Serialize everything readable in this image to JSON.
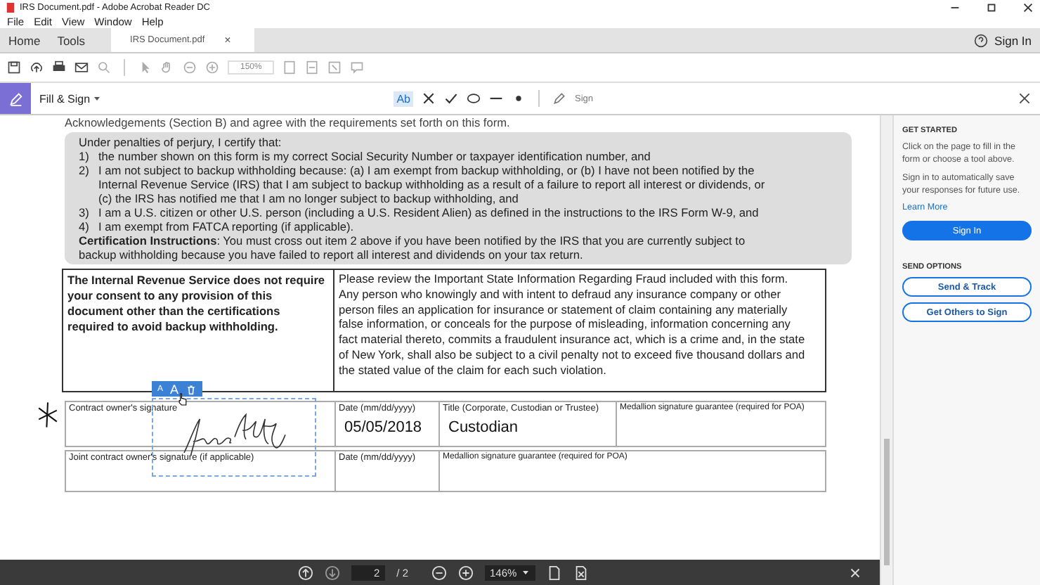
{
  "window": {
    "title": "IRS Document.pdf - Adobe Acrobat Reader DC"
  },
  "menu": [
    "File",
    "Edit",
    "View",
    "Window",
    "Help"
  ],
  "tabs": [
    {
      "label": "Home",
      "selected": false,
      "kind": "nav"
    },
    {
      "label": "Tools",
      "selected": false,
      "kind": "nav"
    },
    {
      "label": "IRS Document.pdf",
      "selected": true,
      "kind": "document",
      "close": "×"
    }
  ],
  "account": {
    "sign_in": "Sign In"
  },
  "toolbar": {
    "zoom": "150%"
  },
  "fill_sign": {
    "title": "Fill & Sign",
    "text_tool": "Ab",
    "sign": "Sign"
  },
  "document": {
    "cut_line": "Acknowledgements (Section B) and agree with the requirements set forth on this form.",
    "certification": {
      "intro": "Under penalties of perjury, I certify that:",
      "items": [
        {
          "num": "1)",
          "text": "the number shown on this form is my correct Social Security Number or taxpayer identification number, and"
        },
        {
          "num": "2)",
          "text": "I am not subject to backup withholding because: (a) I am exempt from backup withholding, or (b) I have not been notified by the Internal Revenue Service (IRS) that I am subject to backup withholding as a result of a failure to report all interest or dividends, or (c) the IRS has notified me that I am no longer subject to backup withholding, and"
        },
        {
          "num": "3)",
          "text": "I am a U.S. citizen or other U.S. person (including a U.S. Resident Alien) as defined in the instructions to the IRS Form W-9, and"
        },
        {
          "num": "4)",
          "text": "I am exempt from FATCA reporting (if applicable)."
        }
      ],
      "instructions": "**Certification Instructions**:  You must cross out item 2 above if you have been notified by the IRS that you are currently subject to backup withholding because you have failed to report all interest and dividends on your tax return."
    },
    "notice": {
      "left": "The Internal Revenue Service does not require your consent to any provision of this document other than the certifications required to avoid backup withholding.",
      "right": "Please review the Important State Information Regarding Fraud included with this form.  Any person who knowingly and with intent to defraud any insurance company or other person files an application for insurance or statement of claim containing any materially false information, or conceals for the purpose of misleading, information concerning any fact material thereto, commits a fraudulent insurance act, which is a crime and, in the state of New York, shall also be subject to a civil penalty not to exceed five thousand dollars and the stated value of the claim for each such violation."
    },
    "signature_rows": [
      {
        "cells": [
          {
            "label": "Contract owner's signature",
            "kind": "signature"
          },
          {
            "label": "Date (mm/dd/yyyy)",
            "value": "05/05/2018",
            "kind": "date"
          },
          {
            "label": "Title (Corporate, Custodian or Trustee)",
            "value": "Custodian",
            "kind": "title"
          },
          {
            "label": "Medallion signature guarantee (required for POA)",
            "kind": "medallion"
          }
        ]
      },
      {
        "cells": [
          {
            "label": "Joint contract owner's signature (if applicable)",
            "kind": "signature"
          },
          {
            "label": "Date (mm/dd/yyyy)",
            "kind": "date"
          },
          {
            "label": "Medallion signature guarantee (required for POA)",
            "kind": "wide"
          }
        ]
      }
    ],
    "field_toolbar": {
      "smaller": "A",
      "larger": "A"
    }
  },
  "panel": {
    "heading": "GET STARTED",
    "hint": "Click on the page to fill in the form or choose a tool above.",
    "save_hint": "Sign in to automatically save your responses for future use.",
    "learn_more": "Learn More",
    "sign_in": "Sign In",
    "send_heading": "SEND OPTIONS",
    "buttons": [
      "Send & Track",
      "Get Others to Sign"
    ]
  },
  "bottom_bar": {
    "page": "2",
    "total": "/ 2",
    "zoom": "146%"
  }
}
